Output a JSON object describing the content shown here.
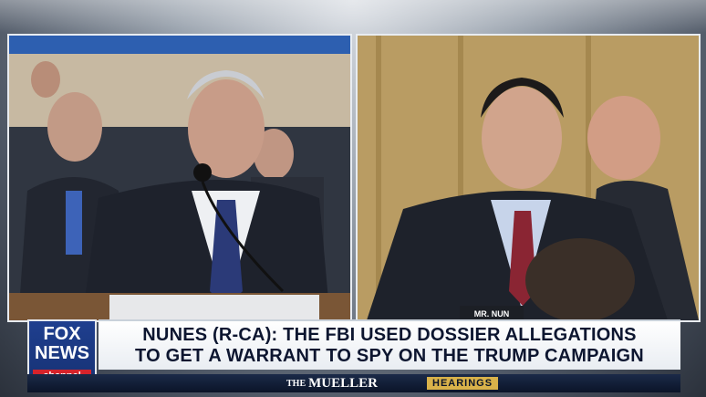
{
  "broadcast": {
    "headline_line1": "NUNES (R-CA): THE FBI USED DOSSIER ALLEGATIONS",
    "headline_line2": "TO GET A WARRANT TO SPY ON THE TRUMP CAMPAIGN",
    "program_prefix": "THE",
    "program_name": "MUELLER",
    "program_tag": "HEARINGS",
    "nameplate": "MR. NUN"
  },
  "logo": {
    "line1": "FOX",
    "line2": "NEWS",
    "channel": "channel"
  },
  "colors": {
    "fox_blue": "#1f3f8f",
    "fox_red": "#d5232b",
    "hearings_gold": "#d9b24a",
    "headline_text": "#0d1630"
  }
}
